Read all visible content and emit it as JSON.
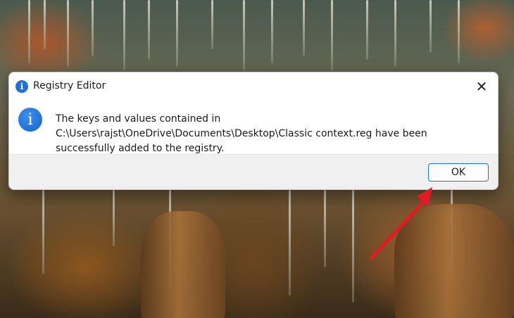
{
  "dialog": {
    "title": "Registry Editor",
    "title_icon": "info-icon",
    "close_label": "✕",
    "message_icon": "info-icon",
    "message": "The keys and values contained in C:\\Users\\rajst\\OneDrive\\Documents\\Desktop\\Classic context.reg have been successfully added to the registry.",
    "ok_label": "OK"
  },
  "colors": {
    "accent": "#1f73d6",
    "annotation_arrow": "#e11b22",
    "footer_bg": "#f0f0f0"
  }
}
